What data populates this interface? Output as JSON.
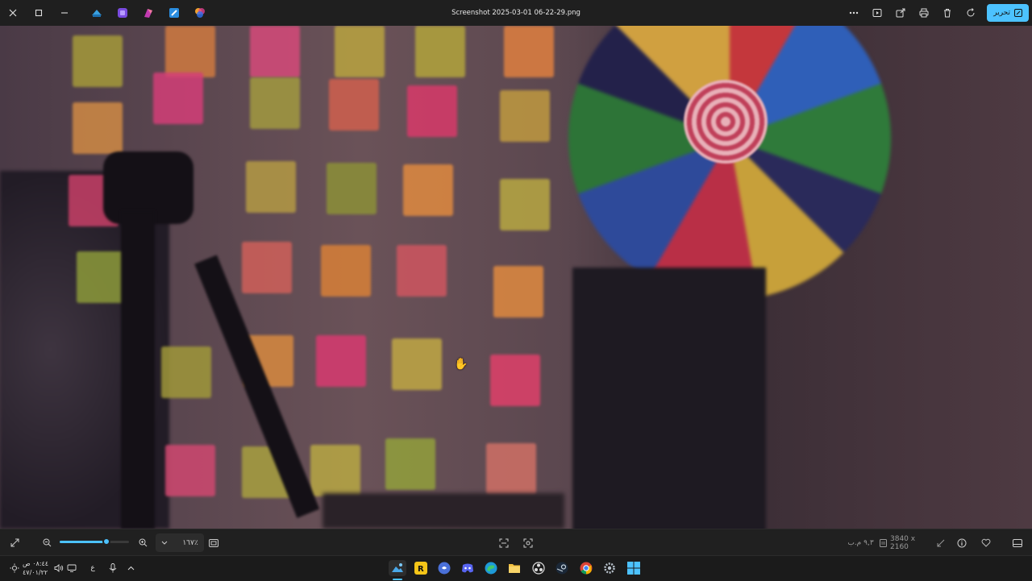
{
  "titlebar": {
    "file_name": "Screenshot 2025-03-01 06-22-29.png",
    "edit_label": "تحرير",
    "close_icon": "close-icon",
    "restore_icon": "restore-icon",
    "minimize_icon": "minimize-icon",
    "quick_apps": [
      "clipchamp-icon",
      "designer-icon",
      "onenote-icon",
      "paint-icon",
      "photos-copilot-icon"
    ],
    "actions": [
      "more-icon",
      "slideshow-icon",
      "share-icon",
      "print-icon",
      "delete-icon",
      "rotate-icon"
    ]
  },
  "viewer": {
    "zoom_percent": "١٦٧٪",
    "zoom_level": 0.67,
    "file_size": "٩,٣ م.ب",
    "dimensions": "3840 x 2160",
    "colors": {
      "accent": "#4cc2ff",
      "chrome": "#1f1f1f"
    }
  },
  "taskbar": {
    "time": "٠٨:٤٤ ص",
    "date": "٤٧/٠١/٢٢",
    "lang": "ع",
    "apps": [
      "photos-icon",
      "rockstar-icon",
      "discord-ptb-icon",
      "discord-icon",
      "edge-icon",
      "file-explorer-icon",
      "obs-icon",
      "steam-icon",
      "chrome-icon",
      "settings-icon",
      "start-icon"
    ]
  }
}
